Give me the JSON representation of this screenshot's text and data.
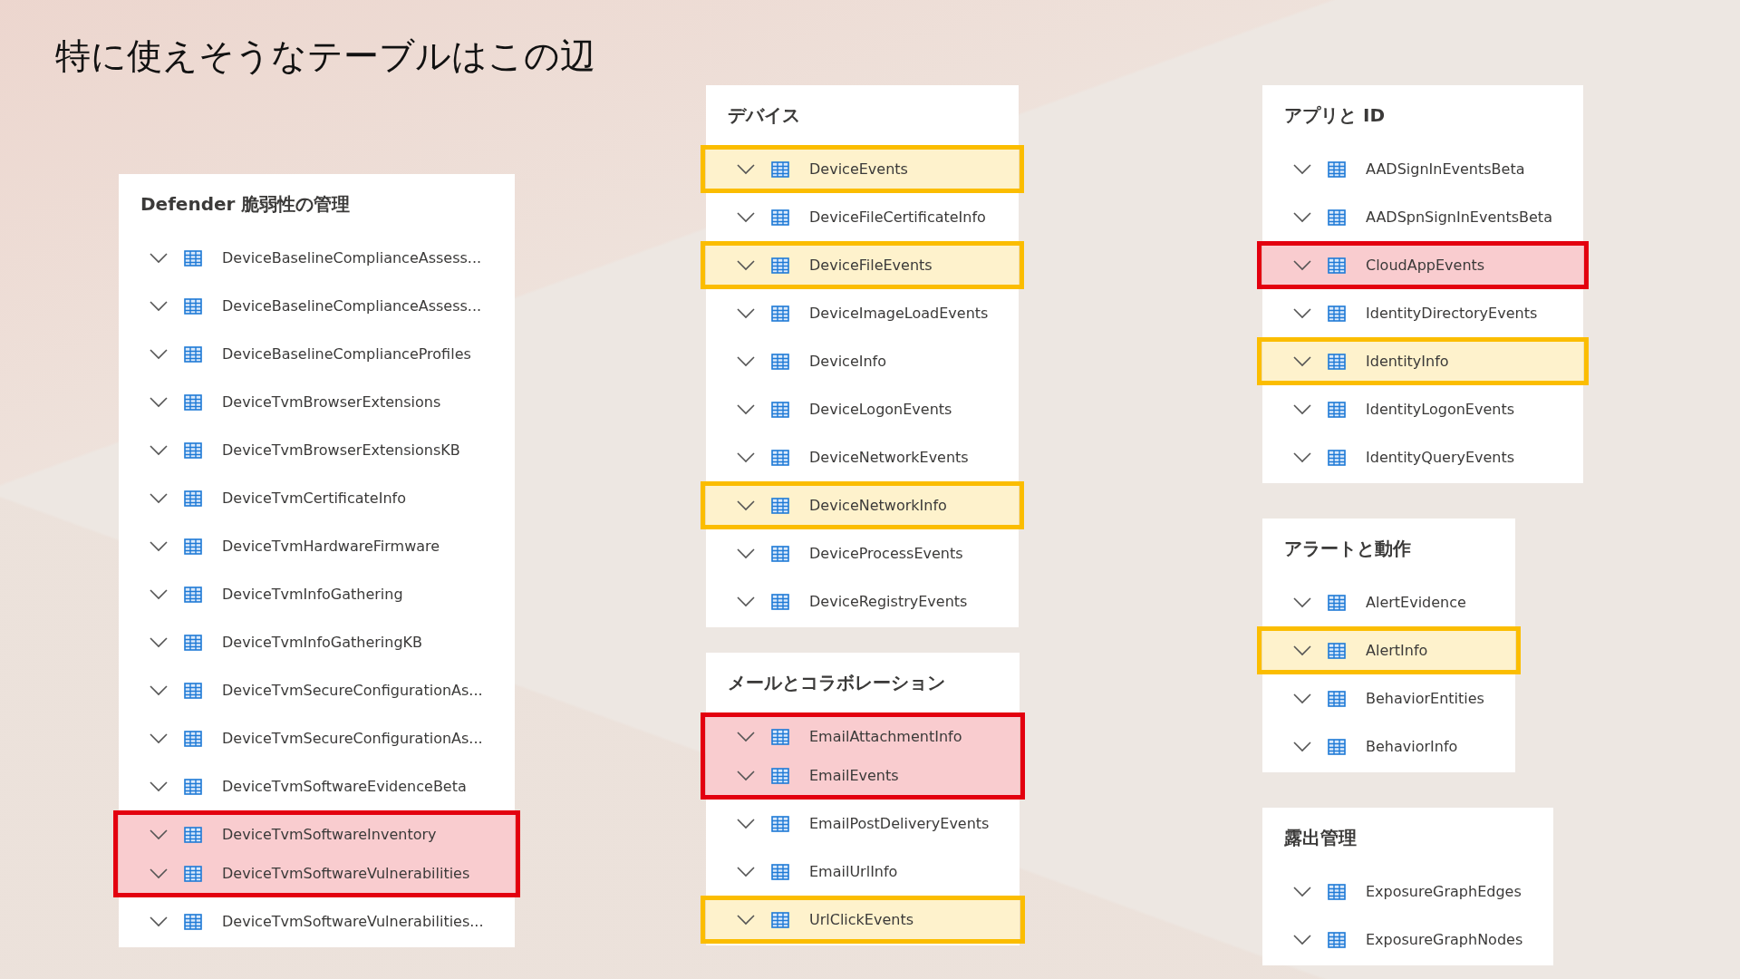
{
  "title": "特に使えそうなテーブルはこの辺",
  "columns": [
    {
      "panels": [
        {
          "header": "Defender 脆弱性の管理",
          "rows": [
            {
              "name": "DeviceBaselineComplianceAssess...",
              "highlighted": false
            },
            {
              "name": "DeviceBaselineComplianceAssess...",
              "highlighted": false
            },
            {
              "name": "DeviceBaselineComplianceProfiles",
              "highlighted": false
            },
            {
              "name": "DeviceTvmBrowserExtensions",
              "highlighted": false
            },
            {
              "name": "DeviceTvmBrowserExtensionsKB",
              "highlighted": false
            },
            {
              "name": "DeviceTvmCertificateInfo",
              "highlighted": false
            },
            {
              "name": "DeviceTvmHardwareFirmware",
              "highlighted": false
            },
            {
              "name": "DeviceTvmInfoGathering",
              "highlighted": false
            },
            {
              "name": "DeviceTvmInfoGatheringKB",
              "highlighted": false
            },
            {
              "name": "DeviceTvmSecureConfigurationAs...",
              "highlighted": false
            },
            {
              "name": "DeviceTvmSecureConfigurationAs...",
              "highlighted": false
            },
            {
              "name": "DeviceTvmSoftwareEvidenceBeta",
              "highlighted": false
            },
            {
              "name": "DeviceTvmSoftwareInventory",
              "highlighted": true,
              "color": "#e3000f"
            },
            {
              "name": "DeviceTvmSoftwareVulnerabilities",
              "highlighted": true,
              "color": "#e3000f"
            },
            {
              "name": "DeviceTvmSoftwareVulnerabilities...",
              "highlighted": false
            }
          ]
        }
      ]
    },
    {
      "panels": [
        {
          "header": "デバイス",
          "rows": [
            {
              "name": "DeviceEvents",
              "highlighted": true,
              "color": "#fbbd00"
            },
            {
              "name": "DeviceFileCertificateInfo",
              "highlighted": false
            },
            {
              "name": "DeviceFileEvents",
              "highlighted": true,
              "color": "#fbbd00"
            },
            {
              "name": "DeviceImageLoadEvents",
              "highlighted": false
            },
            {
              "name": "DeviceInfo",
              "highlighted": false
            },
            {
              "name": "DeviceLogonEvents",
              "highlighted": false
            },
            {
              "name": "DeviceNetworkEvents",
              "highlighted": false
            },
            {
              "name": "DeviceNetworkInfo",
              "highlighted": true,
              "color": "#fbbd00"
            },
            {
              "name": "DeviceProcessEvents",
              "highlighted": false
            },
            {
              "name": "DeviceRegistryEvents",
              "highlighted": false
            }
          ]
        },
        {
          "header": "メールとコラボレーション",
          "rows": [
            {
              "name": "EmailAttachmentInfo",
              "highlighted": true,
              "color": "#e3000f"
            },
            {
              "name": "EmailEvents",
              "highlighted": true,
              "color": "#e3000f"
            },
            {
              "name": "EmailPostDeliveryEvents",
              "highlighted": false
            },
            {
              "name": "EmailUrlInfo",
              "highlighted": false
            },
            {
              "name": "UrlClickEvents",
              "highlighted": true,
              "color": "#fbbd00"
            }
          ]
        }
      ]
    },
    {
      "panels": [
        {
          "header": "アプリと ID",
          "rows": [
            {
              "name": "AADSignInEventsBeta",
              "highlighted": false
            },
            {
              "name": "AADSpnSignInEventsBeta",
              "highlighted": false
            },
            {
              "name": "CloudAppEvents",
              "highlighted": true,
              "color": "#e3000f"
            },
            {
              "name": "IdentityDirectoryEvents",
              "highlighted": false
            },
            {
              "name": "IdentityInfo",
              "highlighted": true,
              "color": "#fbbd00"
            },
            {
              "name": "IdentityLogonEvents",
              "highlighted": false
            },
            {
              "name": "IdentityQueryEvents",
              "highlighted": false
            }
          ]
        },
        {
          "header": "アラートと動作",
          "rows": [
            {
              "name": "AlertEvidence",
              "highlighted": false
            },
            {
              "name": "AlertInfo",
              "highlighted": true,
              "color": "#fbbd00"
            },
            {
              "name": "BehaviorEntities",
              "highlighted": false
            },
            {
              "name": "BehaviorInfo",
              "highlighted": false
            }
          ]
        },
        {
          "header": "露出管理",
          "rows": [
            {
              "name": "ExposureGraphEdges",
              "highlighted": false
            },
            {
              "name": "ExposureGraphNodes",
              "highlighted": false
            }
          ]
        }
      ]
    }
  ]
}
